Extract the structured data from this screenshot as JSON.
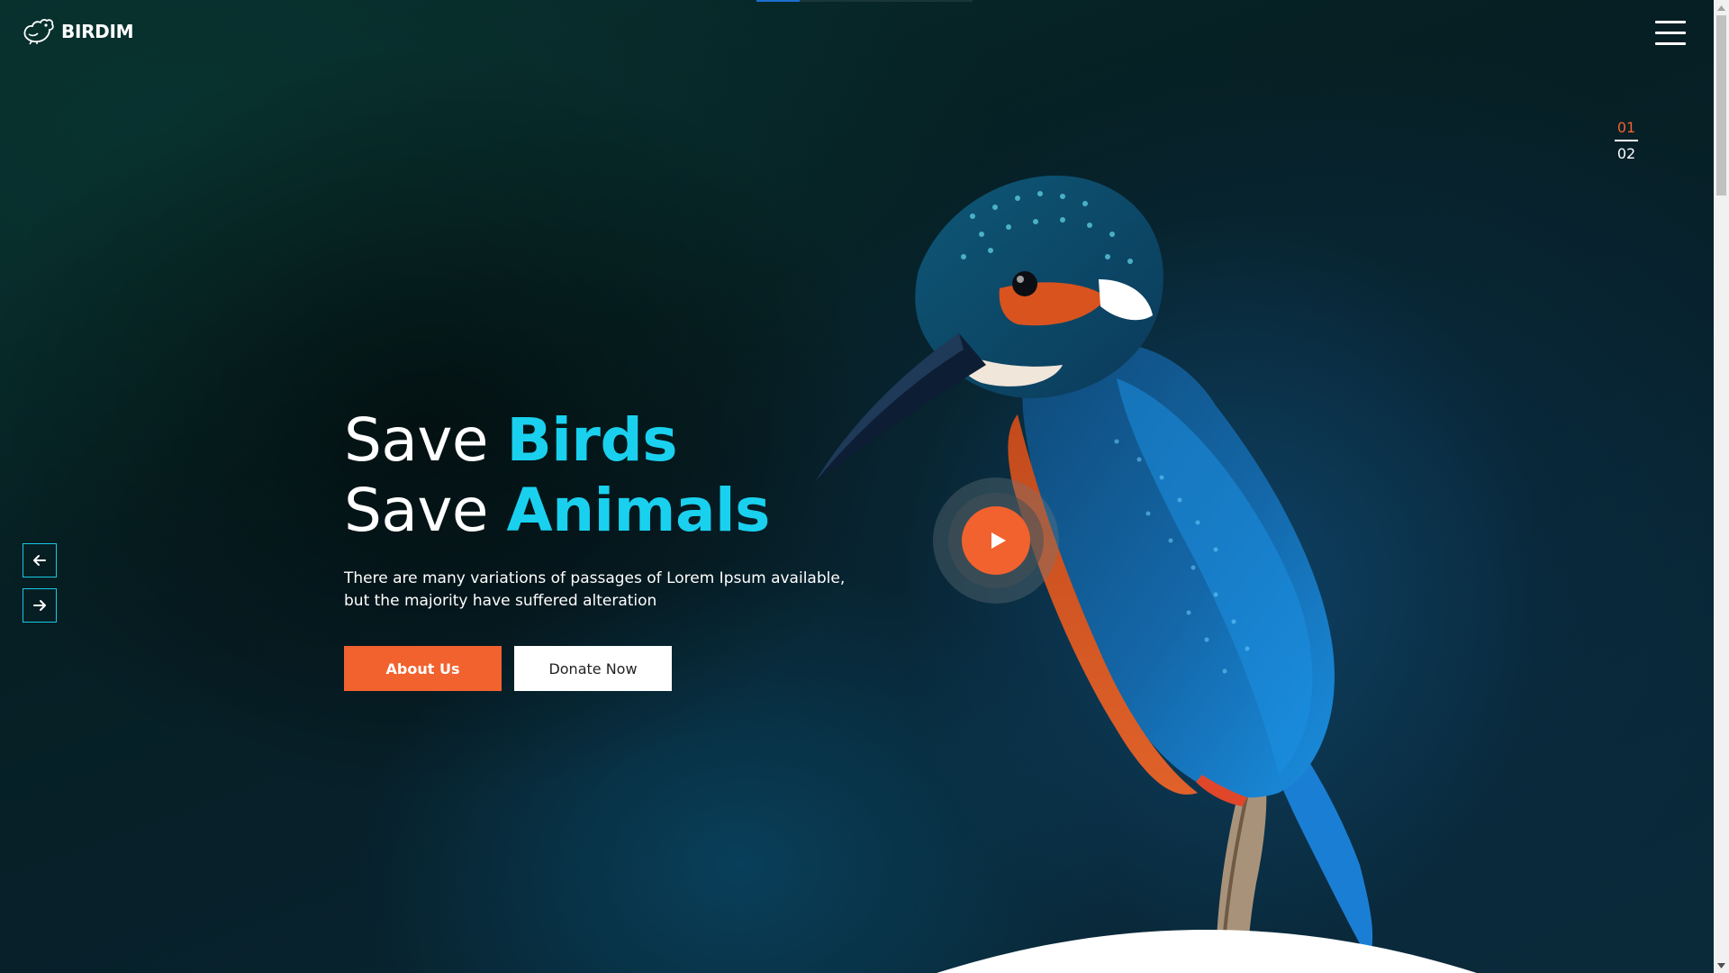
{
  "brand": {
    "name": "BIRDIM",
    "logo_icon": "bird-logo-icon"
  },
  "nav": {
    "menu_icon": "hamburger-menu-icon"
  },
  "slider": {
    "current": "01",
    "total": "02",
    "prev_icon": "arrow-left-icon",
    "next_icon": "arrow-right-icon",
    "progress": 0.2
  },
  "hero": {
    "line1_plain": "Save ",
    "line1_accent": "Birds",
    "line2_plain": "Save ",
    "line2_accent": "Animals",
    "description": "There are many variations of passages of Lorem Ipsum available, but the majority have suffered alteration",
    "primary_button": "About Us",
    "secondary_button": "Donate Now",
    "play_icon": "play-icon"
  },
  "colors": {
    "accent_cyan": "#19d1ef",
    "accent_orange": "#f2622e",
    "background": "#061f23"
  }
}
